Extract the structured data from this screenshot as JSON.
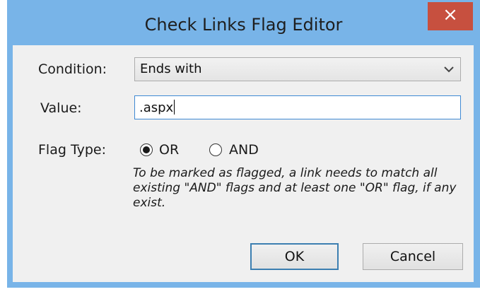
{
  "window": {
    "title": "Check Links Flag Editor",
    "close_glyph": "×"
  },
  "form": {
    "condition_label": "Condition:",
    "condition_value": "Ends with",
    "value_label": "Value:",
    "value_text": ".aspx",
    "flag_type_label": "Flag Type:",
    "options": [
      {
        "label": "OR",
        "selected": true
      },
      {
        "label": "AND",
        "selected": false
      }
    ],
    "note": "To be marked as flagged, a link needs to match all existing \"AND\" flags and at least one \"OR\" flag, if any exist."
  },
  "buttons": {
    "ok": "OK",
    "cancel": "Cancel"
  },
  "icons": {
    "close": "close-icon",
    "dropdown": "chevron-down-icon",
    "radio_selected": "radio-selected-icon",
    "radio_unselected": "radio-unselected-icon"
  },
  "colors": {
    "frame": "#78b4e8",
    "close_button": "#c7503f",
    "client": "#f0f0f0",
    "focus_border": "#3e89d3"
  }
}
